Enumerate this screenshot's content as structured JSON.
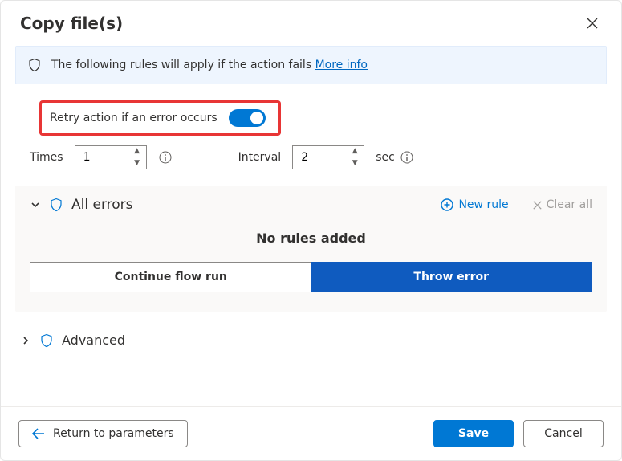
{
  "dialog": {
    "title": "Copy file(s)"
  },
  "banner": {
    "text": "The following rules will apply if the action fails ",
    "link": "More info"
  },
  "retry": {
    "label": "Retry action if an error occurs",
    "enabled": true
  },
  "controls": {
    "times_label": "Times",
    "times_value": "1",
    "interval_label": "Interval",
    "interval_value": "2",
    "interval_unit": "sec"
  },
  "rules": {
    "section_title": "All errors",
    "new_rule": "New rule",
    "clear_all": "Clear all",
    "empty_text": "No rules added",
    "continue_label": "Continue flow run",
    "throw_label": "Throw error"
  },
  "advanced": {
    "label": "Advanced"
  },
  "footer": {
    "return": "Return to parameters",
    "save": "Save",
    "cancel": "Cancel"
  }
}
